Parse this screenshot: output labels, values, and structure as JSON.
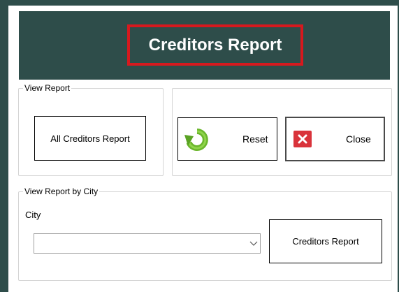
{
  "header": {
    "title": "Creditors Report"
  },
  "view_report": {
    "legend": "View Report",
    "all_creditors_button": "All Creditors Report"
  },
  "actions": {
    "reset_label": "Reset",
    "close_label": "Close",
    "reset_icon": "refresh-icon",
    "close_icon": "close-x-icon",
    "close_icon_color": "#d9333b",
    "reset_icon_color": "#6ab62b"
  },
  "view_by_city": {
    "legend": "View Report by City",
    "city_label": "City",
    "city_value": "",
    "creditors_report_button": "Creditors Report"
  },
  "colors": {
    "background": "#2e4d4a",
    "title_border": "#d7191e"
  }
}
